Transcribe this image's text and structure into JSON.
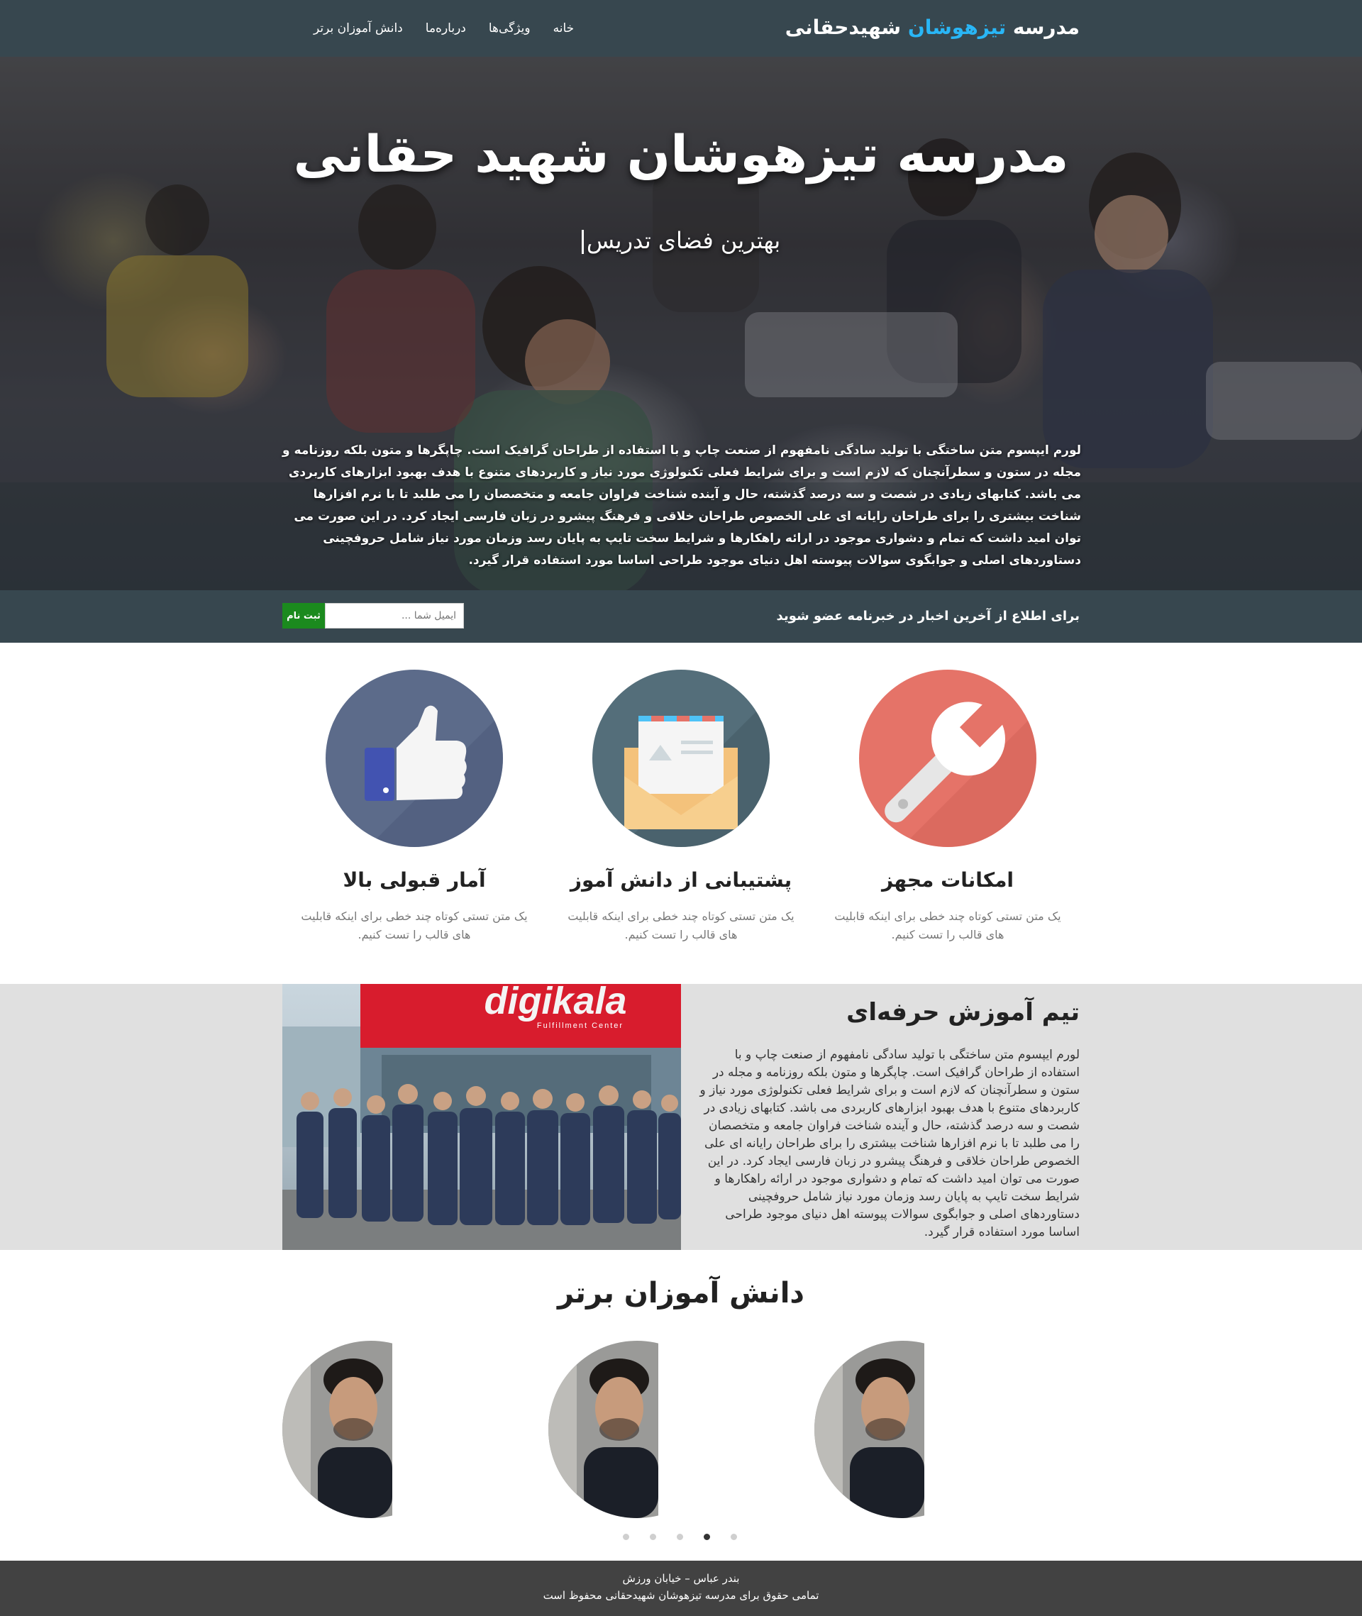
{
  "navbar": {
    "brand_prefix": "مدرسه ",
    "brand_accent": "تیزهوشان",
    "brand_suffix": " شهیدحقانی",
    "links": [
      "خانه",
      "ویژگی‌ها",
      "درباره‌ما",
      "دانش آموزان برتر"
    ]
  },
  "hero": {
    "title": "مدرسه تیزهوشان شهید حقانی",
    "subtitle": "بهترین فضای تدریس",
    "text": "لورم ایپسوم متن ساختگی با تولید سادگی نامفهوم از صنعت چاپ و با استفاده از طراحان گرافیک است. چاپگرها و متون بلکه روزنامه و مجله در ستون و سطرآنچنان که لازم است و برای شرایط فعلی تکنولوژی مورد نیاز و کاربردهای متنوع با هدف بهبود ابزارهای کاربردی می باشد. کتابهای زیادی در شصت و سه درصد گذشته، حال و آینده شناخت فراوان جامعه و متخصصان را می طلبد تا با نرم افزارها شناخت بیشتری را برای طراحان رایانه ای علی الخصوص طراحان خلاقی و فرهنگ پیشرو در زبان فارسی ایجاد کرد. در این صورت می توان امید داشت که تمام و دشواری موجود در ارائه راهکارها و شرایط سخت تایپ به پایان رسد وزمان مورد نیاز شامل حروفچینی دستاوردهای اصلی و جوابگوی سوالات پیوسته اهل دنیای موجود طراحی اساسا مورد استفاده قرار گیرد."
  },
  "newsletter": {
    "label": "برای اطلاع از آخرین اخبار در خبرنامه عضو شوید",
    "placeholder": "ایمیل شما ...",
    "button": "ثبت نام"
  },
  "features": [
    {
      "icon": "wrench-icon",
      "color": "#e57368",
      "title": "امکانات مجهز",
      "text": "یک متن تستی کوتاه چند خطی برای اینکه قابلیت های قالب را تست کنیم."
    },
    {
      "icon": "envelope-icon",
      "color": "#546e7a",
      "title": "پشتیبانی از دانش آموز",
      "text": "یک متن تستی کوتاه چند خطی برای اینکه قابلیت های قالب را تست کنیم."
    },
    {
      "icon": "thumbs-up-icon",
      "color": "#5c6b8a",
      "title": "آمار قبولی بالا",
      "text": "یک متن تستی کوتاه چند خطی برای اینکه قابلیت های قالب را تست کنیم."
    }
  ],
  "team": {
    "title": "تیم آموزش حرفه‌ای",
    "sign_text": "digikala",
    "sign_sub": "Fulfillment Center",
    "text": "لورم ایپسوم متن ساختگی با تولید سادگی نامفهوم از صنعت چاپ و با استفاده از طراحان گرافیک است. چاپگرها و متون بلکه روزنامه و مجله در ستون و سطرآنچنان که لازم است و برای شرایط فعلی تکنولوژی مورد نیاز و کاربردهای متنوع با هدف بهبود ابزارهای کاربردی می باشد. کتابهای زیادی در شصت و سه درصد گذشته، حال و آینده شناخت فراوان جامعه و متخصصان را می طلبد تا با نرم افزارها شناخت بیشتری را برای طراحان رایانه ای علی الخصوص طراحان خلاقی و فرهنگ پیشرو در زبان فارسی ایجاد کرد. در این صورت می توان امید داشت که تمام و دشواری موجود در ارائه راهکارها و شرایط سخت تایپ به پایان رسد وزمان مورد نیاز شامل حروفچینی دستاوردهای اصلی و جوابگوی سوالات پیوسته اهل دنیای موجود طراحی اساسا مورد استفاده قرار گیرد."
  },
  "students": {
    "title": "دانش آموزان برتر",
    "slides": 5,
    "active_slide": 4
  },
  "footer": {
    "address": "بندر عباس – خیابان ورزش",
    "copyright": "تمامی حقوق برای مدرسه تیزهوشان شهیدحقانی محفوظ است"
  }
}
